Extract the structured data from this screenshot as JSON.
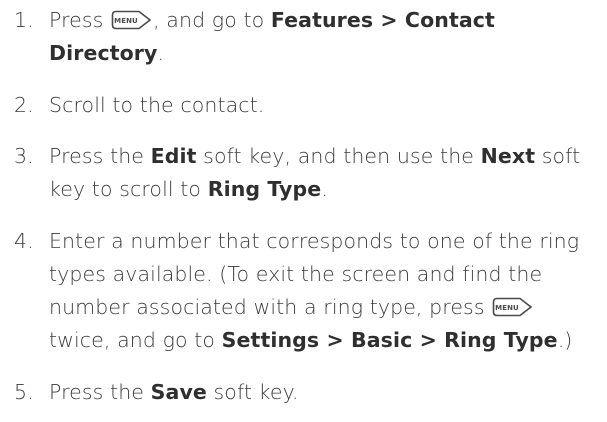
{
  "steps": [
    {
      "number": "1.",
      "parts": [
        {
          "t": "Press "
        },
        {
          "icon": "menu-key-icon",
          "label": "MENU"
        },
        {
          "t": ", and go to "
        },
        {
          "b": "Features > Contact"
        },
        {
          "br": true
        },
        {
          "b": "Directory"
        },
        {
          "t": "."
        }
      ]
    },
    {
      "number": "2.",
      "parts": [
        {
          "t": "Scroll to the contact."
        }
      ]
    },
    {
      "number": "3.",
      "parts": [
        {
          "t": "Press the "
        },
        {
          "b": "Edit"
        },
        {
          "t": " soft key, and then use the "
        },
        {
          "b": "Next"
        },
        {
          "t": " soft"
        },
        {
          "br": true
        },
        {
          "t": "key to scroll to "
        },
        {
          "b": "Ring Type"
        },
        {
          "t": "."
        }
      ]
    },
    {
      "number": "4.",
      "parts": [
        {
          "t": "Enter a number that corresponds to one of the ring"
        },
        {
          "br": true
        },
        {
          "t": "types available. (To exit the screen and find the"
        },
        {
          "br": true
        },
        {
          "t": "number associated with a ring type, press "
        },
        {
          "icon": "menu-key-icon",
          "label": "MENU"
        },
        {
          "br": true
        },
        {
          "t": "twice, and go to "
        },
        {
          "b": "Settings > Basic > Ring Type"
        },
        {
          "t": ".)"
        }
      ]
    },
    {
      "number": "5.",
      "parts": [
        {
          "t": "Press the "
        },
        {
          "b": "Save"
        },
        {
          "t": " soft key."
        }
      ]
    }
  ],
  "colors": {
    "text": "#3a3a3a",
    "bold_text": "#2f2f2f",
    "menu_key_stroke": "#4a4a4a"
  }
}
